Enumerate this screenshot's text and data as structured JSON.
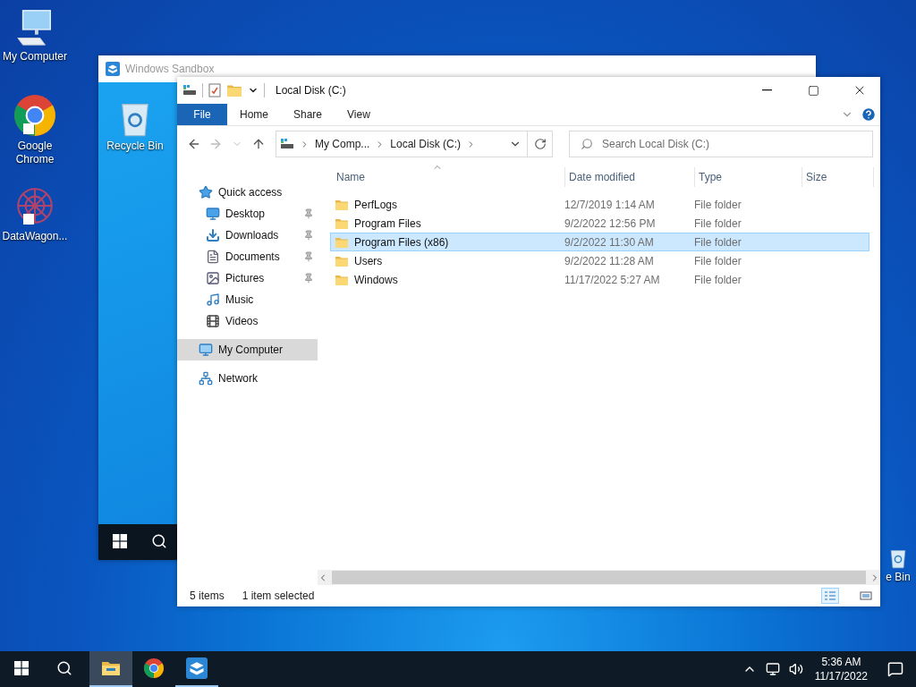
{
  "desktop_icons": [
    {
      "label": "My Computer",
      "kind": "computer"
    },
    {
      "label": "Google Chrome",
      "kind": "chrome"
    },
    {
      "label": "DataWagon...",
      "kind": "app"
    }
  ],
  "sandbox": {
    "title": "Windows Sandbox",
    "desktop_icons": [
      {
        "label": "Recycle Bin",
        "kind": "recycle"
      }
    ]
  },
  "host_icon_partial": {
    "label": "e Bin",
    "kind": "recycle"
  },
  "explorer": {
    "title": "Local Disk (C:)",
    "ribbon_tabs": [
      {
        "label": "File",
        "selected": true
      },
      {
        "label": "Home",
        "selected": false
      },
      {
        "label": "Share",
        "selected": false
      },
      {
        "label": "View",
        "selected": false
      }
    ],
    "breadcrumbs": [
      "My Comp...",
      "Local Disk (C:)"
    ],
    "search": {
      "placeholder": "Search Local Disk (C:)"
    },
    "nav": [
      {
        "label": "Quick access",
        "kind": "star",
        "selected": false,
        "children": [
          {
            "label": "Desktop",
            "kind": "desktop",
            "selected": false,
            "pinned": true
          },
          {
            "label": "Downloads",
            "kind": "download",
            "selected": false,
            "pinned": true
          },
          {
            "label": "Documents",
            "kind": "document",
            "selected": false,
            "pinned": true
          },
          {
            "label": "Pictures",
            "kind": "pictures",
            "selected": false,
            "pinned": true
          },
          {
            "label": "Music",
            "kind": "music",
            "selected": false,
            "pinned": false
          },
          {
            "label": "Videos",
            "kind": "videos",
            "selected": false,
            "pinned": false
          }
        ]
      },
      {
        "label": "My Computer",
        "kind": "computer",
        "selected": true
      },
      {
        "label": "Network",
        "kind": "network",
        "selected": false
      }
    ],
    "columns": [
      "Name",
      "Date modified",
      "Type",
      "Size"
    ],
    "rows": [
      {
        "name": "PerfLogs",
        "date": "12/7/2019 1:14 AM",
        "type": "File folder",
        "selected": false
      },
      {
        "name": "Program Files",
        "date": "9/2/2022 12:56 PM",
        "type": "File folder",
        "selected": false
      },
      {
        "name": "Program Files (x86)",
        "date": "9/2/2022 11:30 AM",
        "type": "File folder",
        "selected": true
      },
      {
        "name": "Users",
        "date": "9/2/2022 11:28 AM",
        "type": "File folder",
        "selected": false
      },
      {
        "name": "Windows",
        "date": "11/17/2022 5:27 AM",
        "type": "File folder",
        "selected": false
      }
    ],
    "status": {
      "count": "5 items",
      "selection": "1 item selected"
    }
  },
  "taskbar": {
    "apps": [
      {
        "kind": "explorer",
        "active": true,
        "running": true
      },
      {
        "kind": "chrome",
        "active": false,
        "running": false
      },
      {
        "kind": "sandbox",
        "active": false,
        "running": true
      }
    ],
    "time": "5:36 AM",
    "date": "11/17/2022"
  }
}
